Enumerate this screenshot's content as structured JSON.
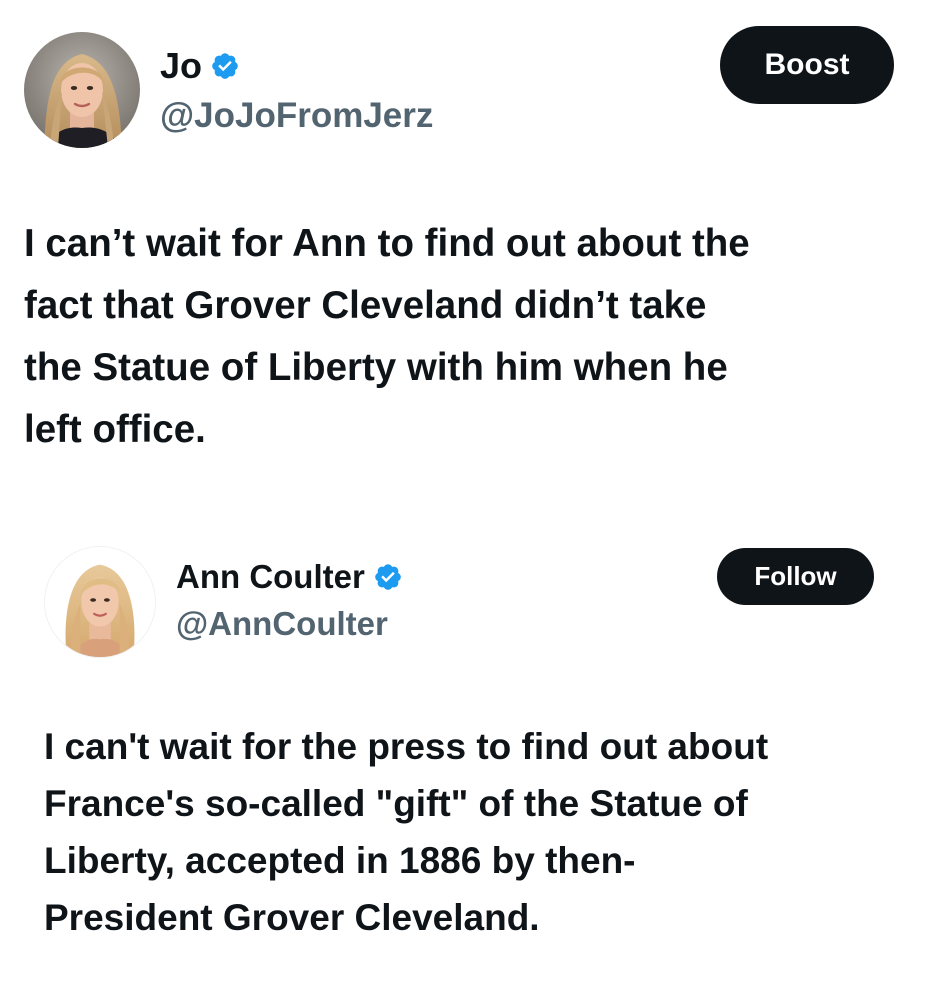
{
  "main_post": {
    "author": {
      "display_name": "Jo",
      "handle": "@JoJoFromJerz",
      "verified": true,
      "avatar_icon": "profile-photo-blonde-woman"
    },
    "boost_label": "Boost",
    "text": "I can’t wait for Ann to find out about the\nfact that Grover Cleveland didn’t take\nthe Statue of Liberty with him when he\nleft office."
  },
  "quoted_post": {
    "author": {
      "display_name": "Ann Coulter",
      "handle": "@AnnCoulter",
      "verified": true,
      "avatar_icon": "profile-photo-blonde-woman"
    },
    "follow_label": "Follow",
    "text": "I can't wait for the press to find out about\nFrance's so-called \"gift\" of the Statue of\nLiberty, accepted in 1886 by then-\nPresident Grover Cleveland."
  },
  "colors": {
    "text_primary": "#0f1419",
    "text_secondary": "#536471",
    "verified_badge": "#1d9bf0",
    "button_background": "#0f1419",
    "button_text": "#ffffff",
    "background": "#ffffff"
  }
}
